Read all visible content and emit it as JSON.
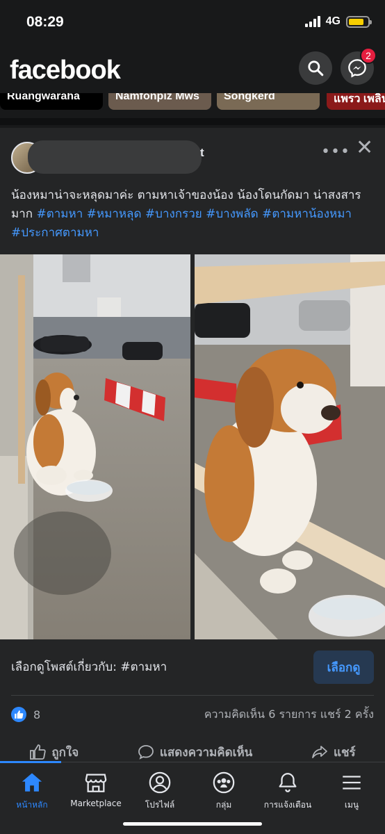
{
  "status_bar": {
    "time": "08:29",
    "network": "4G",
    "battery_level": 0.8
  },
  "header": {
    "logo": "facebook",
    "messenger_badge": "2"
  },
  "stories": [
    {
      "name": "Ruangwaraha",
      "bg": "#000000"
    },
    {
      "name": "Namfonpiz Mws",
      "bg": "#6b5b4e"
    },
    {
      "name": "Songkerd",
      "bg": "#7a6a55"
    },
    {
      "name": "แพรว เพลิน",
      "bg": "#8b1a1a"
    }
  ],
  "post": {
    "author_tail": "t",
    "caption_text": "น้องหมาน่าจะหลุดมาค่ะ ตามหาเจ้าของน้อง น้องโดนกัดมา น่าสงสารมาก ",
    "hashtags": "#ตามหา #หมาหลุด #บางกรวย #บางพลัด #ตามหาน้องหมา #ประกาศตามหา",
    "see_more_text": "เลือกดูโพสต์เกี่ยวกับ: #ตามหา",
    "see_more_button": "เลือกดู",
    "like_count": "8",
    "counts": "ความคิดเห็น 6 รายการ  แชร์ 2 ครั้ง",
    "actions": {
      "like": "ถูกใจ",
      "comment": "แสดงความคิดเห็น",
      "share": "แชร์"
    }
  },
  "tabs": [
    {
      "label": "หน้าหลัก",
      "icon": "home-icon",
      "active": true
    },
    {
      "label": "Marketplace",
      "icon": "marketplace-icon",
      "active": false
    },
    {
      "label": "โปรไฟล์",
      "icon": "profile-icon",
      "active": false
    },
    {
      "label": "กลุ่ม",
      "icon": "groups-icon",
      "active": false
    },
    {
      "label": "การแจ้งเตือน",
      "icon": "bell-icon",
      "active": false
    },
    {
      "label": "เมนู",
      "icon": "menu-icon",
      "active": false
    }
  ],
  "colors": {
    "accent": "#2d88ff",
    "link": "#4599ff",
    "badge": "#e41e3f"
  }
}
